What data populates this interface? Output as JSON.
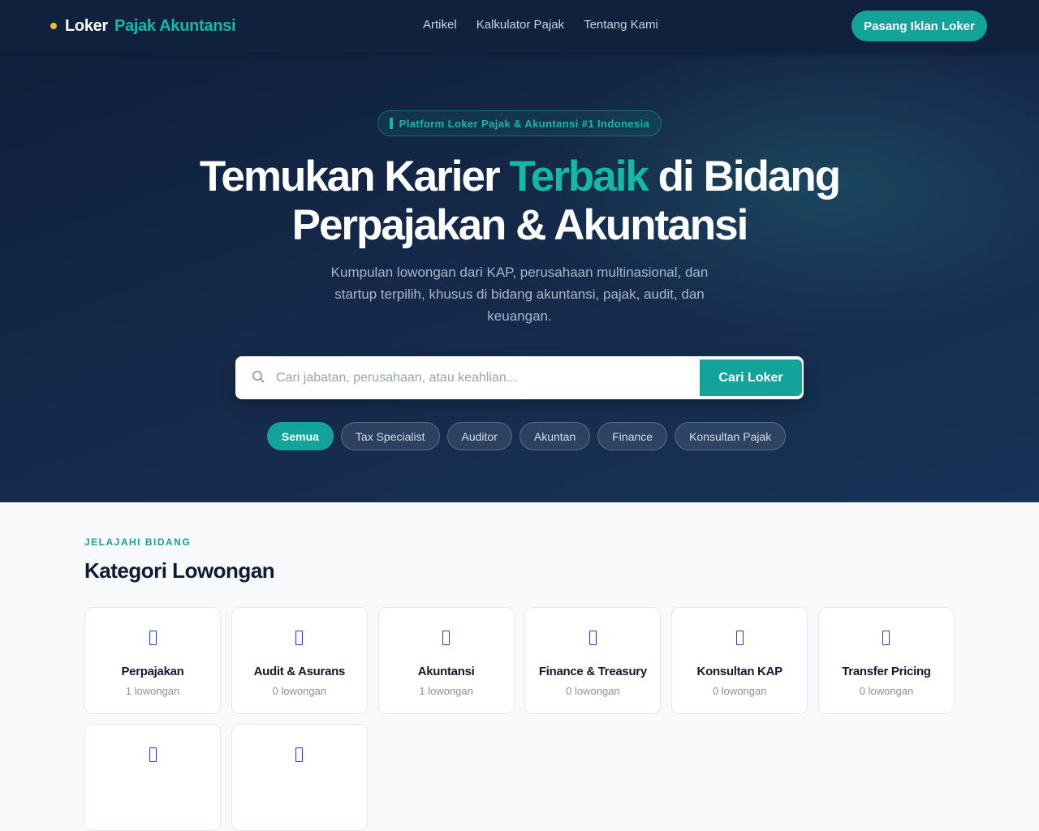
{
  "brand": {
    "part1": "Loker",
    "part2": "Pajak Akuntansi"
  },
  "nav": {
    "links": [
      "Artikel",
      "Kalkulator Pajak",
      "Tentang Kami"
    ],
    "cta": "Pasang Iklan Loker"
  },
  "hero": {
    "badge": "Platform Loker Pajak & Akuntansi #1 Indonesia",
    "title_part1": "Temukan Karier ",
    "title_accent": "Terbaik",
    "title_part2": " di Bidang",
    "title_line2": "Perpajakan & Akuntansi",
    "subtitle": "Kumpulan lowongan dari KAP, perusahaan multinasional, dan startup terpilih, khusus di bidang akuntansi, pajak, audit, dan keuangan."
  },
  "search": {
    "placeholder": "Cari jabatan, perusahaan, atau keahlian...",
    "button": "Cari Loker"
  },
  "chips": [
    {
      "label": "Semua",
      "active": true
    },
    {
      "label": "Tax Specialist",
      "active": false
    },
    {
      "label": "Auditor",
      "active": false
    },
    {
      "label": "Akuntan",
      "active": false
    },
    {
      "label": "Finance",
      "active": false
    },
    {
      "label": "Konsultan Pajak",
      "active": false
    }
  ],
  "categories": {
    "eyebrow": "JELAJAHI BIDANG",
    "title": "Kategori Lowongan",
    "items": [
      {
        "name": "Perpajakan",
        "count": "1 lowongan"
      },
      {
        "name": "Audit & Asurans",
        "count": "0 lowongan"
      },
      {
        "name": "Akuntansi",
        "count": "1 lowongan"
      },
      {
        "name": "Finance & Treasury",
        "count": "0 lowongan"
      },
      {
        "name": "Konsultan KAP",
        "count": "0 lowongan"
      },
      {
        "name": "Transfer Pricing",
        "count": "0 lowongan"
      },
      {
        "name": "",
        "count": ""
      },
      {
        "name": "",
        "count": ""
      }
    ]
  },
  "colors": {
    "accent": "#14a39a",
    "brand_dot": "#f5b942",
    "hero_bg": "#10213d",
    "icon": "#2b3cc4"
  }
}
